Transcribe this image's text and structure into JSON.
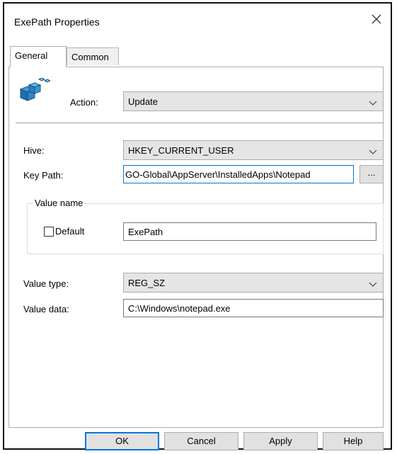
{
  "window": {
    "title": "ExePath Properties"
  },
  "tabs": [
    {
      "label": "General",
      "active": true
    },
    {
      "label": "Common",
      "active": false
    }
  ],
  "general": {
    "action_label": "Action:",
    "action_value": "Update",
    "hive_label": "Hive:",
    "hive_value": "HKEY_CURRENT_USER",
    "key_path_label": "Key Path:",
    "key_path_value": "GO-Global\\AppServer\\InstalledApps\\Notepad",
    "browse_label": "...",
    "value_name_group": "Value name",
    "default_label": "Default",
    "default_checked": false,
    "value_name_value": "ExePath",
    "value_type_label": "Value type:",
    "value_type_value": "REG_SZ",
    "value_data_label": "Value data:",
    "value_data_value": "C:\\Windows\\notepad.exe"
  },
  "buttons": {
    "ok": "OK",
    "cancel": "Cancel",
    "apply": "Apply",
    "help": "Help"
  },
  "icons": {
    "registry": "registry-icon",
    "close": "close-icon",
    "dropdown": "chevron-down-icon"
  },
  "colors": {
    "accent": "#0078d7",
    "combo_bg": "#e5e5e5",
    "button_bg": "#e1e1e1"
  }
}
